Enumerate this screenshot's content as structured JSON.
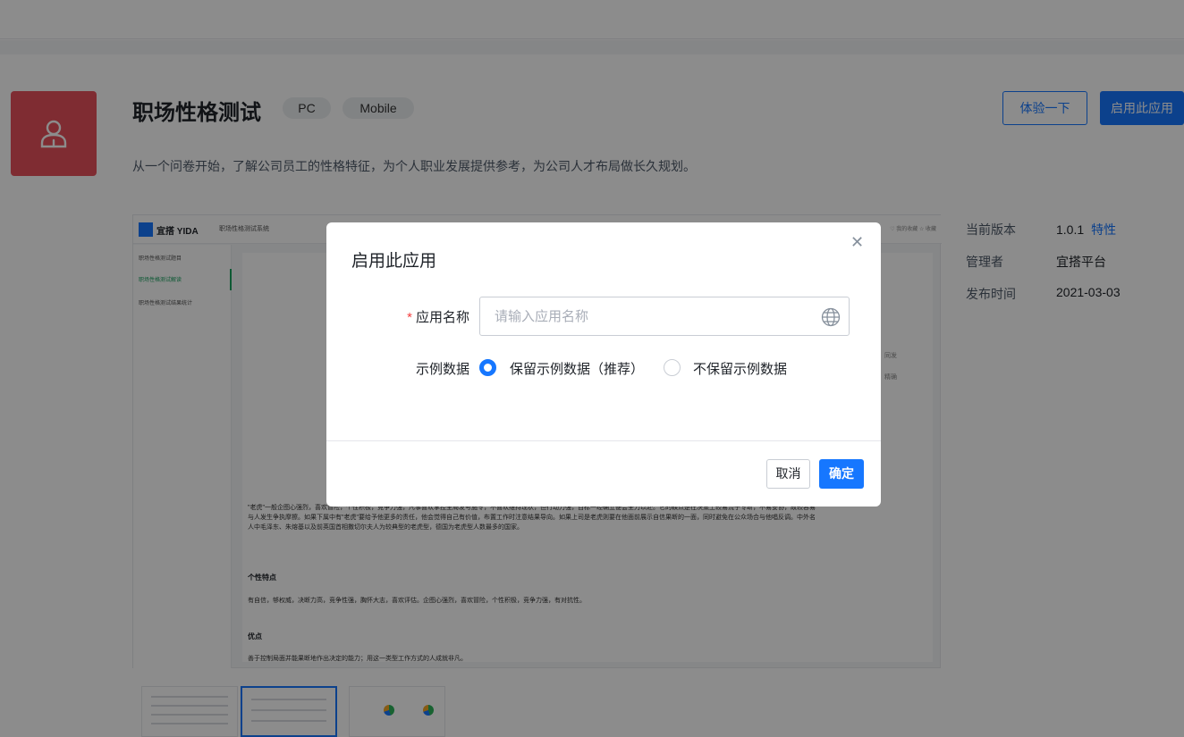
{
  "app": {
    "title": "职场性格测试",
    "tags": [
      "PC",
      "Mobile"
    ],
    "description": "从一个问卷开始，了解公司员工的性格特征，为个人职业发展提供参考，为公司人才布局做长久规划。",
    "icon": "user-icon",
    "icon_color": "#e8505b"
  },
  "actions": {
    "try_label": "体验一下",
    "enable_label": "启用此应用"
  },
  "info": [
    {
      "label": "当前版本",
      "value": "1.0.1",
      "link": "特性"
    },
    {
      "label": "管理者",
      "value": "宜搭平台"
    },
    {
      "label": "发布时间",
      "value": "2021-03-03"
    }
  ],
  "preview": {
    "logo_text": "宜搭 YIDA",
    "system_name": "职场性格测试系统",
    "header_right": "♡ 我的收藏  ☆ 收藏",
    "sidebar": [
      "职场性格测试题目",
      "职场性格测试解读",
      "职场性格测试结果统计"
    ],
    "paragraph_1": "\"老虎\"一般企图心强烈，喜欢冒险，个性积极，竞争力强，凡事喜欢掌控全局发号施令，不喜欢维持现状，但行动力强，目标一经确立便会全力以赴。它的缺点是在决策上较易流于专断，不易妥协，故较容易与人发生争执摩擦。如果下属中有\"老虎\"要给予他更多的责任，他会觉得自己有价值，布置工作时注意结果导向。如果上司是老虎则要在他面前展示自信果断的一面，同时避免在公众场合与他唱反调。中外名人中毛泽东、朱熔基以及前英国首相撒切尔夫人为较典型的老虎型，德国为老虎型人数最多的国家。",
    "heading_1": "个性特点",
    "paragraph_2": "有自信，够权威，决断力高，竞争性强，胸怀大志，喜欢评估。企图心强烈，喜欢冒险，个性积极，竞争力强，有对抗性。",
    "heading_2": "优点",
    "paragraph_3": "善于控制局面并能果断地作出决定的能力；用这一类型工作方式的人成就非凡。",
    "fragment_1": "同发",
    "fragment_2": "精确"
  },
  "modal": {
    "title": "启用此应用",
    "name_label": "应用名称",
    "name_value": "",
    "name_placeholder": "请输入应用名称",
    "sample_label": "示例数据",
    "option_keep": "保留示例数据（推荐）",
    "option_discard": "不保留示例数据",
    "selected_option": "keep",
    "cancel_label": "取消",
    "ok_label": "确定",
    "close_icon": "close-icon",
    "field_icon": "globe-icon"
  },
  "colors": {
    "primary": "#1677ff",
    "required": "#f53f3f",
    "active_nav": "#1aa260"
  }
}
